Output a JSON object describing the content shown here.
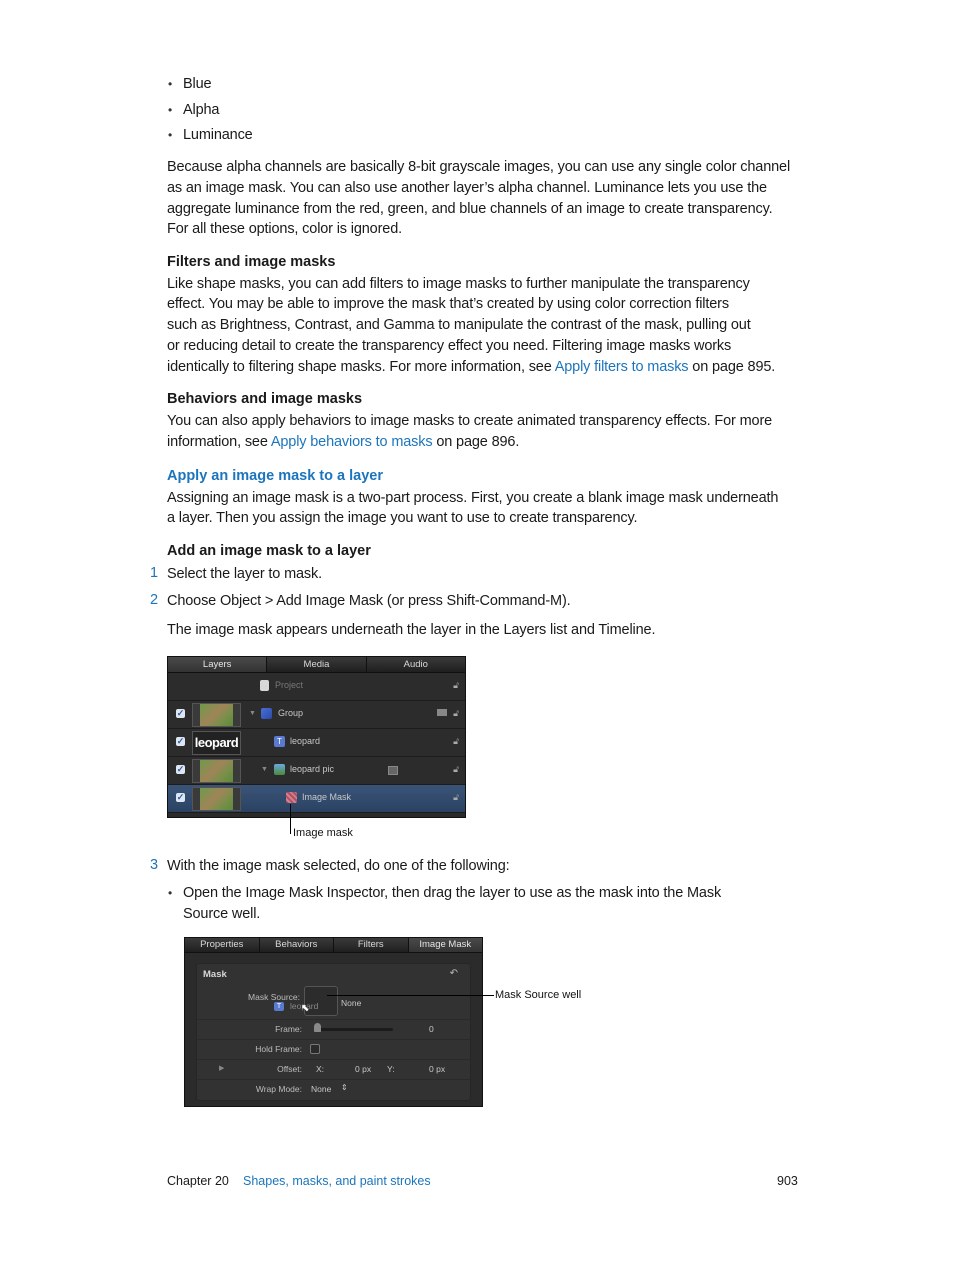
{
  "bullets_top": [
    "Blue",
    "Alpha",
    "Luminance"
  ],
  "intro_paragraph": [
    "Because alpha channels are basically 8-bit grayscale images, you can use any single color channel",
    "as an image mask. You can also use another layer’s alpha channel. Luminance lets you use the",
    "aggregate luminance from the red, green, and blue channels of an image to create transparency.",
    "For all these options, color is ignored."
  ],
  "filters_section": {
    "heading": "Filters and image masks",
    "lines": [
      "Like shape masks, you can add filters to image masks to further manipulate the transparency",
      "effect. You may be able to improve the mask that’s created by using color correction filters",
      "such as Brightness, Contrast, and Gamma to manipulate the contrast of the mask, pulling out",
      "or reducing detail to create the transparency effect you need. Filtering image masks works"
    ],
    "last_line_prefix": "identically to filtering shape masks. For more information, see ",
    "link": "Apply filters to masks",
    "last_line_suffix": " on page 895."
  },
  "behaviors_section": {
    "heading": "Behaviors and image masks",
    "line1": "You can also apply behaviors to image masks to create animated transparency effects. For more",
    "line2_prefix": "information, see ",
    "link": "Apply behaviors to masks",
    "line2_suffix": " on page 896."
  },
  "apply_section": {
    "heading": "Apply an image mask to a layer",
    "lines": [
      "Assigning an image mask is a two-part process. First, you create a blank image mask underneath",
      "a layer. Then you assign the image you want to use to create transparency."
    ]
  },
  "task": {
    "heading": "Add an image mask to a layer",
    "steps": [
      {
        "num": "1",
        "text": "Select the layer to mask."
      },
      {
        "num": "2",
        "text": "Choose Object > Add Image Mask (or press Shift-Command-M)."
      },
      {
        "num": "3",
        "text": "With the image mask selected, do one of the following:"
      }
    ],
    "step2_result": "The image mask appears underneath the layer in the Layers list and Timeline.",
    "step3_bullet_line1": "Open the Image Mask Inspector, then drag the layer to use as the mask into the Mask",
    "step3_bullet_line2": "Source well."
  },
  "layers_panel": {
    "tabs": [
      "Layers",
      "Media",
      "Audio"
    ],
    "active_tab": "Layers",
    "rows": [
      {
        "name": "Project",
        "checked": false,
        "thumb": "none",
        "icon": "project-icon"
      },
      {
        "name": "Group",
        "checked": true,
        "thumb": "leopard-photo",
        "icon": "group-icon"
      },
      {
        "name": "leopard",
        "checked": true,
        "thumb": "leopard-text",
        "icon": "text-layer-icon",
        "thumb_text": "leopard"
      },
      {
        "name": "leopard pic",
        "checked": true,
        "thumb": "leopard-photo",
        "icon": "image-layer-icon"
      },
      {
        "name": "Image Mask",
        "checked": true,
        "thumb": "leopard-photo",
        "icon": "image-mask-icon",
        "selected": true
      }
    ],
    "callout": "Image mask"
  },
  "inspector_panel": {
    "tabs": [
      "Properties",
      "Behaviors",
      "Filters",
      "Image Mask"
    ],
    "active_tab": "Image Mask",
    "group_title": "Mask",
    "mask_source_label": "Mask Source:",
    "mask_source_drag_name": "leopard",
    "mask_source_value": "None",
    "frame_label": "Frame:",
    "frame_value": "0",
    "hold_frame_label": "Hold Frame:",
    "offset_label": "Offset:",
    "offset_x_label": "X:",
    "offset_x_value": "0 px",
    "offset_y_label": "Y:",
    "offset_y_value": "0 px",
    "wrap_mode_label": "Wrap Mode:",
    "wrap_mode_value": "None",
    "callout": "Mask Source well"
  },
  "footer": {
    "chapter": "Chapter 20",
    "chapter_title": "Shapes, masks, and paint strokes",
    "page": "903"
  }
}
